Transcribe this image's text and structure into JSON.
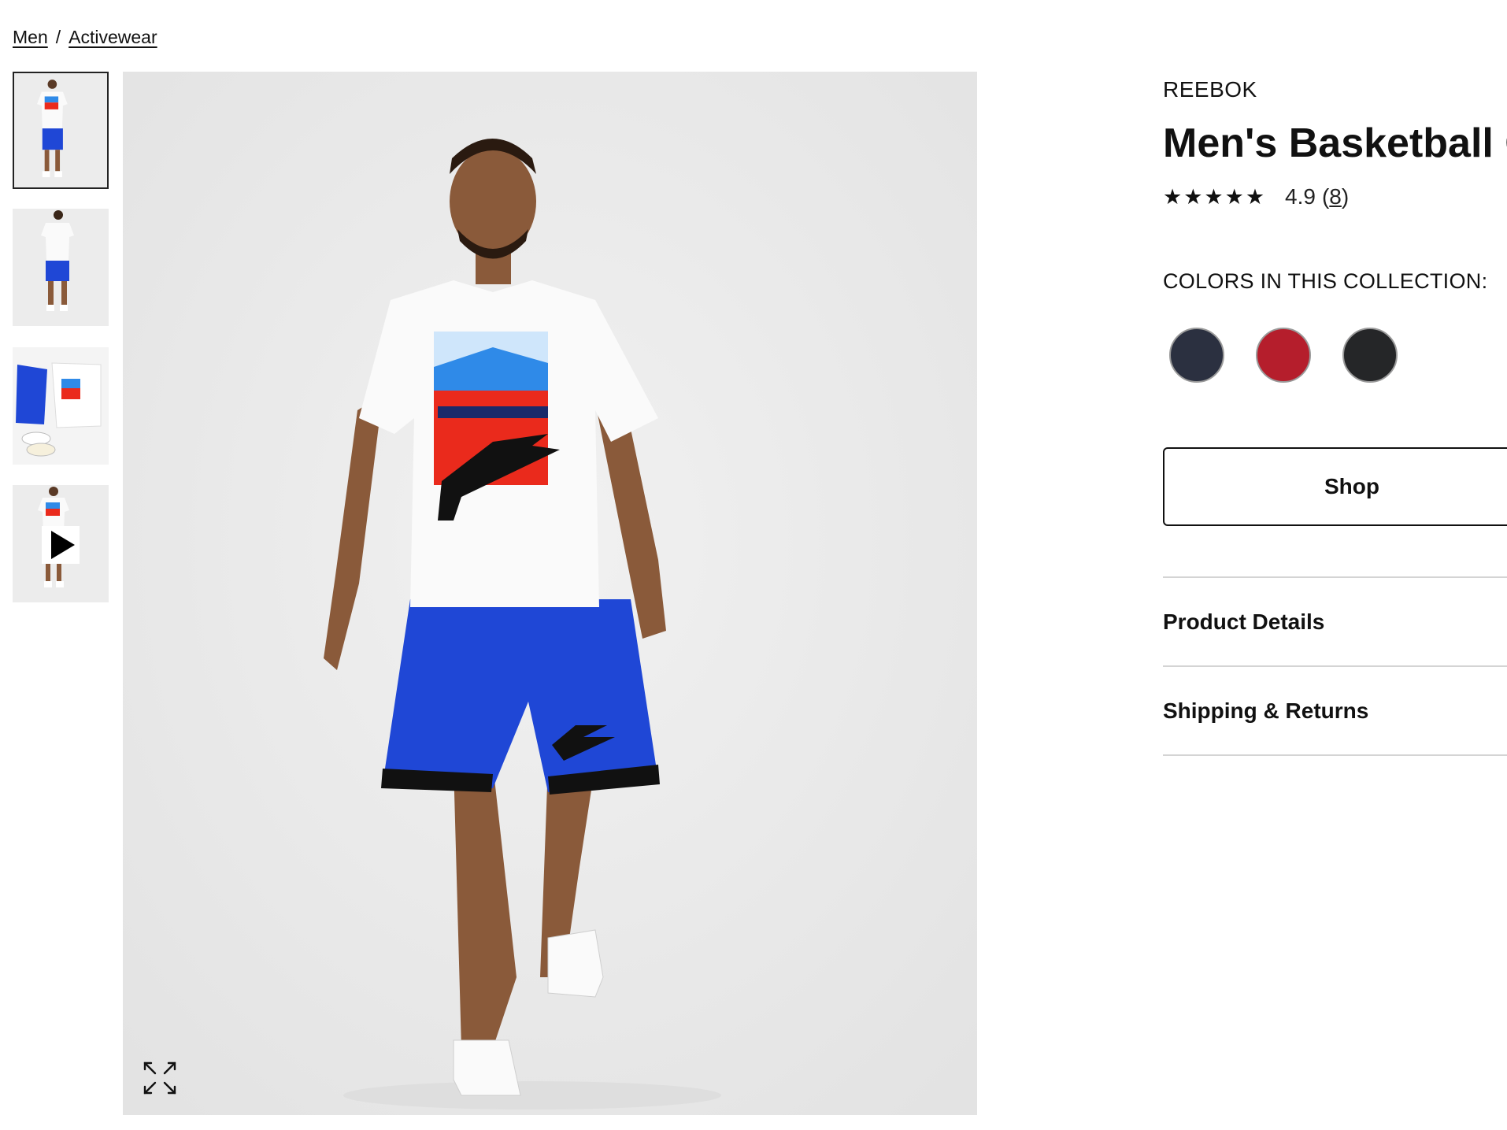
{
  "breadcrumb": {
    "items": [
      "Men",
      "Activewear"
    ],
    "separator": "/"
  },
  "thumbnails": [
    {
      "label": "thumbnail-front",
      "active": true
    },
    {
      "label": "thumbnail-back",
      "active": false
    },
    {
      "label": "thumbnail-flatlay",
      "active": false
    },
    {
      "label": "thumbnail-video",
      "active": false,
      "has_play_icon": true
    }
  ],
  "product": {
    "brand": "REEBOK",
    "title": "Men's Basketball G",
    "stars": "★★★★★",
    "rating": "4.9",
    "review_count_prefix": "(",
    "review_count": "8",
    "review_count_suffix": ")",
    "rating_value": 4.9
  },
  "colors": {
    "label": "COLORS IN THIS COLLECTION:",
    "swatches": [
      {
        "name": "navy",
        "color": "#2b3040"
      },
      {
        "name": "red",
        "color": "#b51e2c"
      },
      {
        "name": "black",
        "color": "#252628"
      }
    ]
  },
  "shop_button": {
    "label": "Shop"
  },
  "accordion": {
    "items": [
      "Product Details",
      "Shipping & Returns"
    ]
  },
  "icons": {
    "play": "play-icon",
    "expand": "expand-icon"
  },
  "theme": {
    "accent_blue": "#1f47d6",
    "tee_red": "#ea2a1c",
    "tee_blue": "#2f8ae8"
  }
}
